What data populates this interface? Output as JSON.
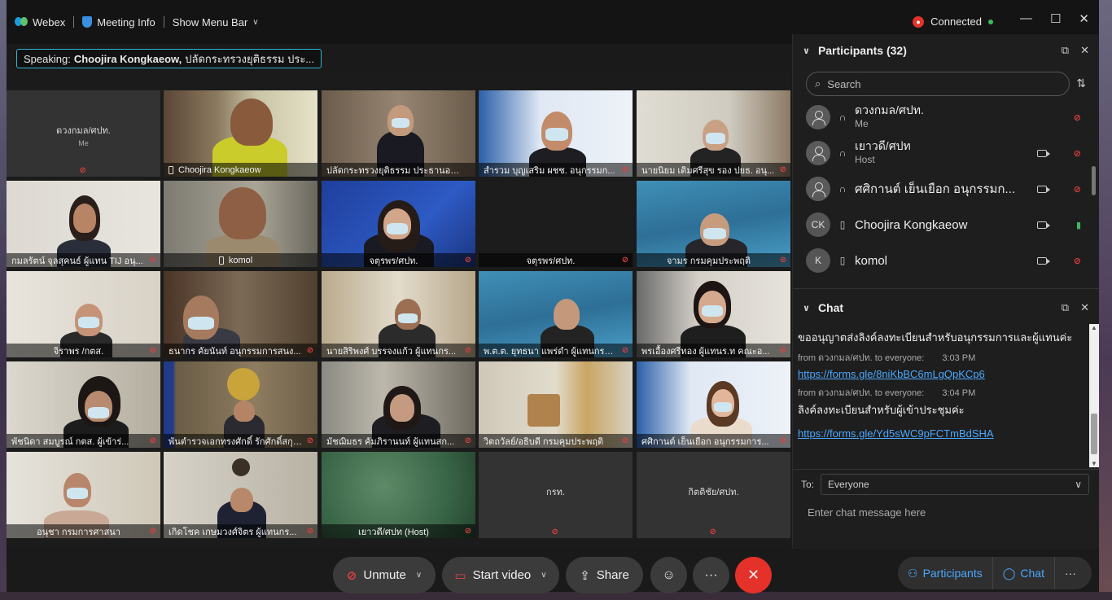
{
  "topbar": {
    "app_name": "Webex",
    "meeting_info": "Meeting Info",
    "show_menu_bar": "Show Menu Bar",
    "status": "Connected"
  },
  "speaking": {
    "prefix": "Speaking:",
    "name": "Choojira Kongkaeow,",
    "rest": "ปลัดกระทรวงยุติธรรม ประ..."
  },
  "tiles": [
    {
      "label": "ดวงกมล/ศปท.",
      "sub": "Me",
      "noname": true
    },
    {
      "label": "Choojira Kongkaeow",
      "phone": true
    },
    {
      "label": "ปลัดกระทรวงยุติธรรม ประธานอนุกรรม..."
    },
    {
      "label": "สำรวม บุญเสริม ผชช. อนุกรรมก..."
    },
    {
      "label": "นายนิยม เติมศรีสุข รอง ปยธ. อนุ..."
    },
    {
      "label": "กมลรัตน์ จุลสุคนธ์ ผู้แทน TIJ อนุ..."
    },
    {
      "label": "komol",
      "phone": true
    },
    {
      "label": "จตุรพร/ศปท."
    },
    {
      "label": "จตุรพร/ศปท."
    },
    {
      "label": "จามร กรมคุมประพฤติ"
    },
    {
      "label": "จิราพร /กตส."
    },
    {
      "label": "ธนากร คัยนันท์ อนุกรรมการสนง..."
    },
    {
      "label": "นายสิริพงศ์ บรรจงแก้ว ผู้แทนกร..."
    },
    {
      "label": "พ.ต.ต. ยุทธนา แพร่ดำ ผู้แทนกรมคุ้มค..."
    },
    {
      "label": "พรเอื้องศรีทอง ผู้แทนร.ท คณะอ..."
    },
    {
      "label": "พัชนิดา สมบูรณ์ กตส. ผู้เข้าร่..."
    },
    {
      "label": "พันตำรวจเอกทรงศักดิ์ รักศักดิ์สกุล ผู้อ..."
    },
    {
      "label": "มัชฌิมธร คัมภิรานนท์ ผู้แทนสก..."
    },
    {
      "label": "วิตถวัลย์/อธิบดี กรมคุมประพฤติ"
    },
    {
      "label": "ศศิกานต์ เย็นเยือก อนุกรรมการ..."
    },
    {
      "label": "อนุชา กรมการศาสนา"
    },
    {
      "label": "เกิดโชค เกษมวงศ์จิตร ผู้แทนกร..."
    },
    {
      "label": "เยาวดี/ศปท (Host)"
    },
    {
      "label": "กรท.",
      "noname": true
    },
    {
      "label": "กิตติชัย/ศปท.",
      "noname": true
    }
  ],
  "participants": {
    "title": "Participants (32)",
    "search_placeholder": "Search",
    "list": [
      {
        "name": "ดวงกมล/ศปท.",
        "role": "Me",
        "avatar": "",
        "device": "headset",
        "video": false,
        "mic": "off"
      },
      {
        "name": "เยาวดี/ศปท",
        "role": "Host",
        "avatar": "",
        "device": "headset",
        "video": true,
        "mic": "off"
      },
      {
        "name": "ศศิกานต์ เย็นเยือก อนุกรรมก...",
        "role": "",
        "avatar": "",
        "device": "headset",
        "video": true,
        "mic": "off"
      },
      {
        "name": "Choojira Kongkaeow",
        "role": "",
        "avatar": "CK",
        "device": "phone",
        "video": true,
        "mic": "on"
      },
      {
        "name": "komol",
        "role": "",
        "avatar": "K",
        "device": "phone",
        "video": true,
        "mic": "off"
      }
    ]
  },
  "chat": {
    "title": "Chat",
    "messages": [
      {
        "type": "text",
        "text": "ขออนุญาตส่งลิงค์ลงทะเบียนสำหรับอนุกรรมการและผู้แทนค่ะ"
      },
      {
        "type": "meta",
        "from": "from ดวงกมล/ศปท. to everyone:",
        "time": "3:03 PM"
      },
      {
        "type": "link",
        "text": "https://forms.gle/8niKbBC6mLgQpKCp6"
      },
      {
        "type": "meta",
        "from": "from ดวงกมล/ศปท. to everyone:",
        "time": "3:04 PM"
      },
      {
        "type": "text",
        "text": "ลิงค์ลงทะเบียนสำหรับผู้เข้าประชุมค่ะ"
      },
      {
        "type": "link",
        "text": "https://forms.gle/Yd5sWC9pFCTmBdSHA"
      }
    ],
    "to_label": "To:",
    "to_value": "Everyone",
    "input_placeholder": "Enter chat message here"
  },
  "controls": {
    "unmute": "Unmute",
    "start_video": "Start video",
    "share": "Share",
    "participants": "Participants",
    "chat": "Chat"
  },
  "colors": {
    "accent": "#2fb6d8",
    "link": "#4aa8ff",
    "end_call": "#e4322b",
    "muted": "#e24040",
    "connected": "#3dbb5c"
  }
}
